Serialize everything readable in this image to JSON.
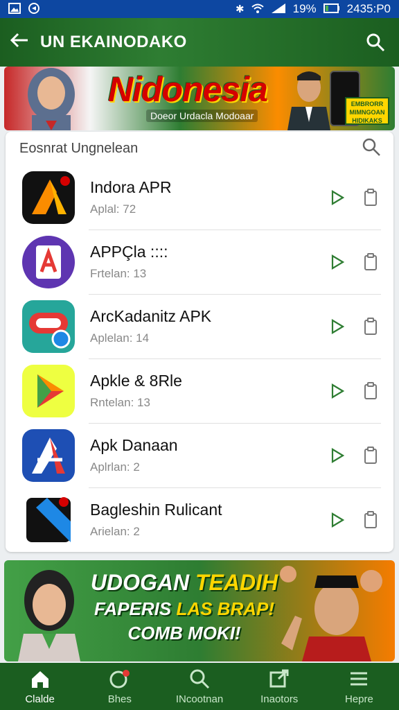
{
  "status_bar": {
    "battery": "19%",
    "time": "2435:P0"
  },
  "appbar": {
    "title": "UN EKAINODAKO"
  },
  "hero": {
    "headline": "Nidonesia",
    "subtitle": "Doeor Urdacla Modoaar",
    "badge": "EMBRORR MIMNGOAN HIDIKAKS"
  },
  "list_card": {
    "title": "Eosnrat Ungnelean",
    "items": [
      {
        "name": "Indora APR",
        "meta": "Aplal: 72",
        "icon": "orange-triangle-logo-icon"
      },
      {
        "name": "APPÇla     ::::",
        "meta": "Frtelan: 13",
        "icon": "purple-a-logo-icon"
      },
      {
        "name": "ArcKadanitz APK",
        "meta": "Aplelan: 14",
        "icon": "teal-red-badge-icon"
      },
      {
        "name": "Apkle & 8Rle",
        "meta": "Rntelan: 13",
        "icon": "yellow-play-triangle-icon"
      },
      {
        "name": "Apk Danaan",
        "meta": "Aplrlan: 2",
        "icon": "blue-a-logo-icon"
      },
      {
        "name": "Bagleshin Rulicant",
        "meta": "Arielan: 2",
        "icon": "black-blue-ribbon-icon"
      }
    ]
  },
  "promo": {
    "line1_a": "UDOGAN",
    "line1_b": "TEADIH",
    "line2_a": "FAPERIS",
    "line2_b": "LAS BRAP!",
    "line3": "COMB MOKI!"
  },
  "bottom_nav": [
    {
      "label": "Clalde",
      "icon": "home-icon",
      "active": true
    },
    {
      "label": "Bhes",
      "icon": "circle-notification-icon",
      "active": false
    },
    {
      "label": "INcootnan",
      "icon": "search-icon",
      "active": false
    },
    {
      "label": "Inaotors",
      "icon": "share-box-icon",
      "active": false
    },
    {
      "label": "Hepre",
      "icon": "menu-icon",
      "active": false
    }
  ],
  "colors": {
    "appbar": "#1b5e20",
    "status_bar": "#0d47a1",
    "accent_green": "#2e7d32",
    "accent_yellow": "#ffd600"
  }
}
